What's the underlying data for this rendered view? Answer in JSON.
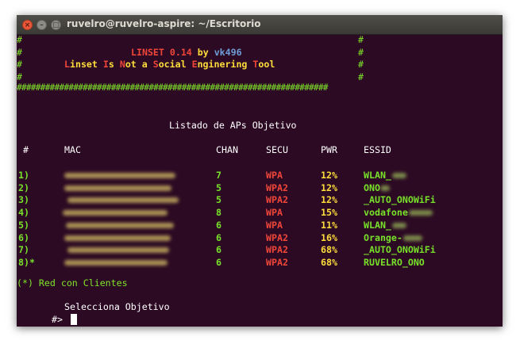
{
  "window": {
    "title": "ruvelro@ruvelro-aspire: ~/Escritorio"
  },
  "banner": {
    "hash_row": "##################################################################",
    "edge": "#",
    "title_name": "LINSET 0.14",
    "title_by": " by ",
    "title_author": "vk496",
    "acronym": [
      {
        "c": "L",
        "rest": "inset "
      },
      {
        "c": "I",
        "rest": "s "
      },
      {
        "c": "N",
        "rest": "ot a "
      },
      {
        "c": "S",
        "rest": "ocial "
      },
      {
        "c": "E",
        "rest": "nginering "
      },
      {
        "c": "T",
        "rest": "ool"
      }
    ]
  },
  "table": {
    "title": "Listado de APs Objetivo",
    "headers": {
      "num": "#",
      "mac": "MAC",
      "chan": "CHAN",
      "secu": "SECU",
      "pwr": "PWR",
      "essid": "ESSID"
    },
    "rows": [
      {
        "num": "1)",
        "chan": "7",
        "secu": "WPA",
        "pwr": "12%",
        "essid": "WLAN_"
      },
      {
        "num": "2)",
        "chan": "5",
        "secu": "WPA2",
        "pwr": "12%",
        "essid": "ONO"
      },
      {
        "num": "3)",
        "chan": "5",
        "secu": "WPA2",
        "pwr": "12%",
        "essid": "_AUTO_ONOWiFi"
      },
      {
        "num": "4)",
        "chan": "8",
        "secu": "WPA",
        "pwr": "15%",
        "essid": "vodafone"
      },
      {
        "num": "5)",
        "chan": "6",
        "secu": "WPA",
        "pwr": "11%",
        "essid": "WLAN_"
      },
      {
        "num": "6)",
        "chan": "6",
        "secu": "WPA2",
        "pwr": "16%",
        "essid": "Orange-"
      },
      {
        "num": "7)",
        "chan": "6",
        "secu": "WPA2",
        "pwr": "68%",
        "essid": "_AUTO_ONOWiFi"
      },
      {
        "num": "8)*",
        "chan": "6",
        "secu": "WPA2",
        "pwr": "68%",
        "essid": "RUVELRO_ONO"
      }
    ]
  },
  "footer": {
    "clients_note": "(*) Red con Clientes",
    "select_prompt": "Selecciona Objetivo",
    "prompt": "#>"
  }
}
